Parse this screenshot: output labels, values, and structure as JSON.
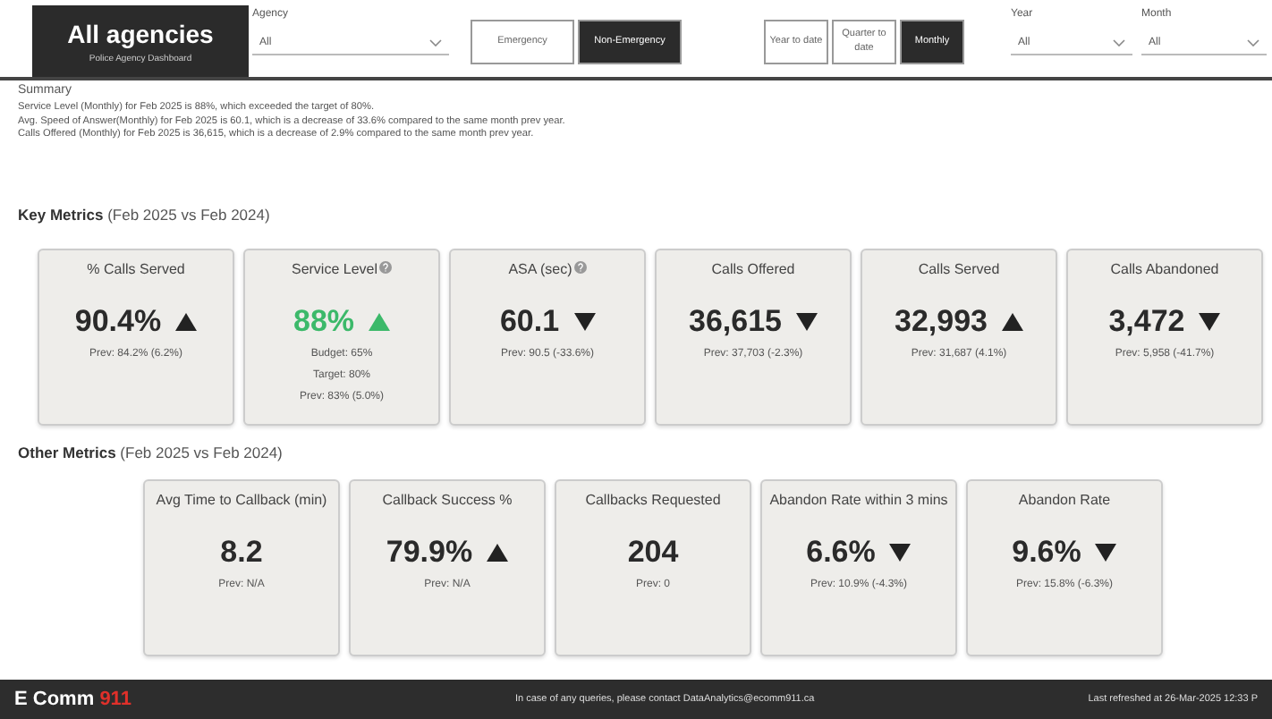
{
  "header": {
    "title": "All agencies",
    "subtitle": "Police Agency Dashboard",
    "filters": [
      {
        "label": "Agency",
        "value": "All"
      },
      {
        "label": "Year",
        "value": "All"
      },
      {
        "label": "Month",
        "value": "All"
      }
    ],
    "call_type": [
      {
        "label": "Emergency",
        "selected": false
      },
      {
        "label": "Non-Emergency",
        "selected": true
      }
    ],
    "period": [
      {
        "label": "Year to date",
        "selected": false
      },
      {
        "label": "Quarter to date",
        "selected": false
      },
      {
        "label": "Monthly",
        "selected": true
      }
    ]
  },
  "summary": {
    "title": "Summary",
    "lines": [
      "Service Level (Monthly) for Feb 2025 is 88%, which exceeded the target of 80%.",
      "Avg. Speed of Answer(Monthly) for Feb 2025 is 60.1, which is a decrease of 33.6% compared to the same month prev year.",
      "Calls Offered (Monthly) for Feb 2025 is 36,615, which is a decrease of 2.9% compared to the same month prev year."
    ]
  },
  "key_metrics": {
    "title": "Key Metrics",
    "period": "(Feb 2025 vs Feb 2024)",
    "cards": [
      {
        "title": "% Calls Served",
        "value": "90.4%",
        "arrow_up": true,
        "help": false,
        "details": [
          "Prev: 84.2% (6.2%)"
        ]
      },
      {
        "title": "Service Level",
        "value": "88%",
        "arrow_up": true,
        "help": true,
        "color": "#3cb96a",
        "details": [
          "Budget: 65%",
          "Target: 80%",
          "Prev: 83% (5.0%)"
        ]
      },
      {
        "title": "ASA (sec)",
        "value": "60.1",
        "arrow_up": false,
        "help": true,
        "details": [
          "Prev: 90.5 (-33.6%)"
        ]
      },
      {
        "title": "Calls Offered",
        "value": "36,615",
        "arrow_up": false,
        "help": false,
        "details": [
          "Prev: 37,703 (-2.3%)"
        ]
      },
      {
        "title": "Calls Served",
        "value": "32,993",
        "arrow_up": true,
        "help": false,
        "details": [
          "Prev: 31,687 (4.1%)"
        ]
      },
      {
        "title": "Calls Abandoned",
        "value": "3,472",
        "arrow_up": false,
        "help": false,
        "details": [
          "Prev: 5,958 (-41.7%)"
        ]
      }
    ]
  },
  "other_metrics": {
    "title": "Other Metrics",
    "period": "(Feb 2025 vs Feb 2024)",
    "cards": [
      {
        "title": "Avg Time to Callback (min)",
        "value": "8.2",
        "help": false,
        "details": [
          "Prev: N/A"
        ]
      },
      {
        "title": "Callback Success %",
        "value": "79.9%",
        "arrow_up": true,
        "help": false,
        "details": [
          "Prev: N/A"
        ]
      },
      {
        "title": "Callbacks Requested",
        "value": "204",
        "help": false,
        "details": [
          "Prev: 0"
        ]
      },
      {
        "title": "Abandon Rate within 3 mins",
        "value": "6.6%",
        "arrow_up": false,
        "help": false,
        "details": [
          "Prev: 10.9% (-4.3%)"
        ]
      },
      {
        "title": "Abandon Rate",
        "value": "9.6%",
        "arrow_up": false,
        "help": false,
        "details": [
          "Prev: 15.8% (-6.3%)"
        ]
      }
    ]
  },
  "footer": {
    "logo": "E Comm",
    "logo_number": "911",
    "contact": "In case of any queries, please contact DataAnalytics@ecomm911.ca",
    "refreshed": "Last refreshed at 26-Mar-2025 12:33 P"
  }
}
